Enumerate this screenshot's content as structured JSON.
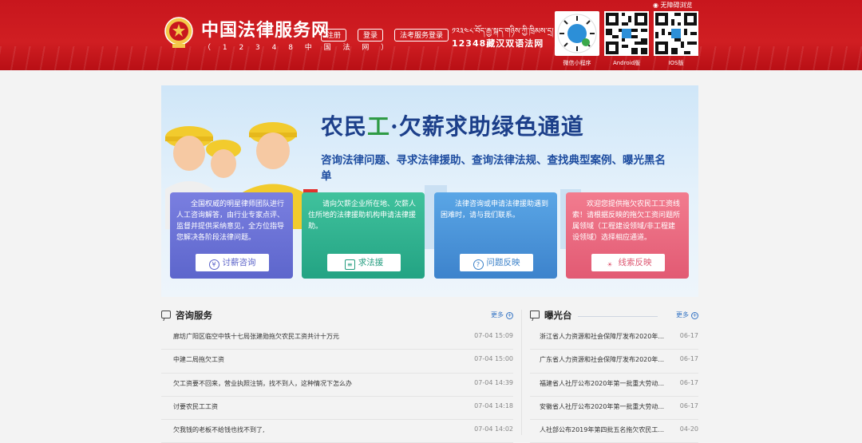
{
  "header": {
    "title": "中国法律服务网",
    "subtitle": "（ 1 2 3 4 8 中 国 法 网 ）",
    "buttons": {
      "register": "注册",
      "login": "登录",
      "exam_login": "法考服务登录"
    },
    "tibetan_text": "༡༢༣༤༨་བོད་རྒྱ་སྐད་གཉིས་ཀྱི་ཁྲིམས་དྲ།",
    "bilingual": "12348藏汉双语法网",
    "accessibility": "无障碍浏览",
    "qr": [
      {
        "label": "微信小程序"
      },
      {
        "label": "Android版"
      },
      {
        "label": "IOS版"
      }
    ],
    "colors": {
      "brand_red": "#c8161d"
    }
  },
  "banner": {
    "title_part1": "农民",
    "title_part2": "工",
    "title_part3": "·欠薪求助绿色通道",
    "description": "咨询法律问题、寻求法律援助、查询法律法规、查找典型案例、曝光黑名单",
    "cards": [
      {
        "text": "全国权威的明星律师团队进行人工咨询解答，由行业专家点评、监督并提供采纳意见，全方位指导您解决各阶段法律问题。",
        "button": "讨薪咨询",
        "icon": "yuan-icon",
        "icon_glyph": "¥"
      },
      {
        "text": "请向欠薪企业所在地、欠薪人住所地的法律援助机构申请法律援助。",
        "button": "求法援",
        "icon": "document-icon",
        "icon_glyph": "≡"
      },
      {
        "text": "法律咨询或申请法律援助遇到困难时，请与我们联系。",
        "button": "问题反映",
        "icon": "question-icon",
        "icon_glyph": "?"
      },
      {
        "text": "欢迎您提供拖欠农民工工资线索！请根据反映的拖欠工资问题所属领域（工程建设领域/非工程建设领域）选择相应通道。",
        "button": "线索反映",
        "icon": "lightbulb-icon",
        "icon_glyph": "☀"
      }
    ]
  },
  "consult": {
    "title": "咨询服务",
    "more": "更多",
    "rows": [
      {
        "title": "廊坊广阳区临空中铁十七局张建勋拖欠农民工资共计十万元",
        "date": "07-04 15:09"
      },
      {
        "title": "中建二局拖欠工资",
        "date": "07-04 15:00"
      },
      {
        "title": "欠工资要不回来，营业执照注销，找不到人，这种情况下怎么办",
        "date": "07-04 14:39"
      },
      {
        "title": "讨要农民工工资",
        "date": "07-04 14:18"
      },
      {
        "title": "欠我钱的老板不给钱也找不到了,",
        "date": "07-04 14:02"
      }
    ]
  },
  "exposure": {
    "title": "曝光台",
    "more": "更多",
    "rows": [
      {
        "title": "浙江省人力资源和社会保障厅发布2020年...",
        "date": "06-17"
      },
      {
        "title": "广东省人力资源和社会保障厅发布2020年...",
        "date": "06-17"
      },
      {
        "title": "福建省人社厅公布2020年第一批重大劳动...",
        "date": "06-17"
      },
      {
        "title": "安徽省人社厅公布2020年第一批重大劳动...",
        "date": "06-17"
      },
      {
        "title": "人社部公布2019年第四批五名拖欠农民工...",
        "date": "04-20"
      }
    ]
  }
}
